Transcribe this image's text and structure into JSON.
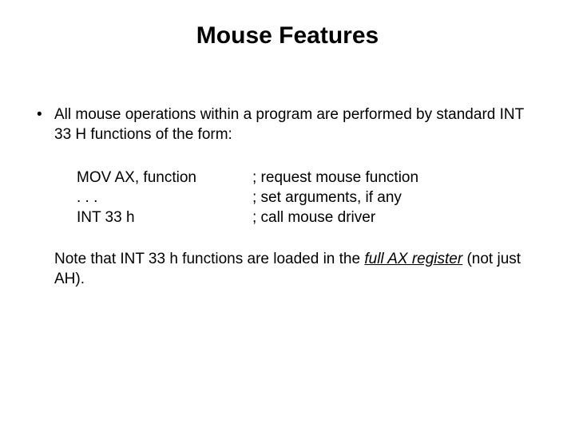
{
  "title": "Mouse Features",
  "bullet": {
    "glyph": "•",
    "text": "All mouse operations within a program are performed by standard INT 33 H functions of the form:"
  },
  "code": {
    "rows": [
      {
        "left": "MOV AX, function",
        "right": "; request mouse function"
      },
      {
        "left": ". . .",
        "right": "; set arguments, if any"
      },
      {
        "left": "INT 33 h",
        "right": "; call mouse driver"
      }
    ]
  },
  "note": {
    "pre": "Note that INT 33 h functions are loaded in the ",
    "emph": "full AX register",
    "post": " (not just AH)."
  }
}
